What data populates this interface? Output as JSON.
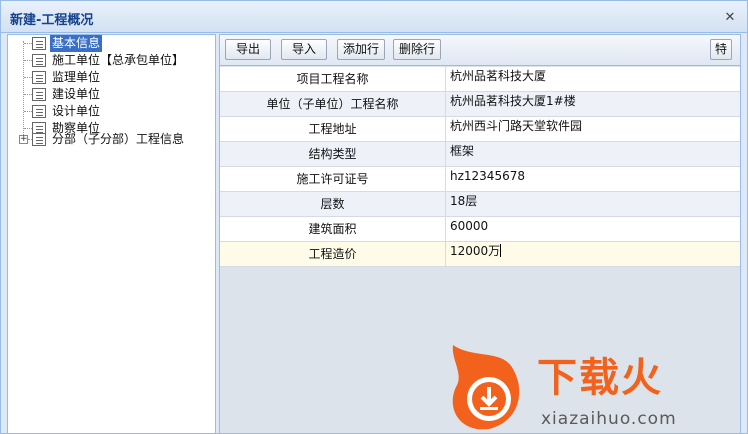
{
  "window": {
    "title": "新建-工程概况",
    "close_icon": "✕"
  },
  "tree": {
    "items": [
      {
        "label": "基本信息",
        "selected": true
      },
      {
        "label": "施工单位【总承包单位】"
      },
      {
        "label": "监理单位"
      },
      {
        "label": "建设单位"
      },
      {
        "label": "设计单位"
      },
      {
        "label": "勘察单位"
      },
      {
        "label": "分部（子分部）工程信息",
        "expander": "+"
      }
    ]
  },
  "toolbar": {
    "export_label": "导出",
    "import_label": "导入",
    "add_row_label": "添加行",
    "delete_row_label": "删除行",
    "special_label": "特"
  },
  "grid": {
    "rows": [
      {
        "key": "项目工程名称",
        "value": "杭州品茗科技大厦"
      },
      {
        "key": "单位（子单位）工程名称",
        "value": "杭州品茗科技大厦1#楼"
      },
      {
        "key": "工程地址",
        "value": "杭州西斗门路天堂软件园"
      },
      {
        "key": "结构类型",
        "value": "框架"
      },
      {
        "key": "施工许可证号",
        "value": "hz12345678"
      },
      {
        "key": "层数",
        "value": "18层"
      },
      {
        "key": "建筑面积",
        "value": "60000"
      },
      {
        "key": "工程造价",
        "value": "12000万"
      }
    ]
  },
  "watermark": {
    "brand": "下载火",
    "url": "xiazaihuo.com"
  },
  "colors": {
    "accent": "#3a6fc7",
    "border": "#99bbe8",
    "logo": "#f2621c"
  }
}
